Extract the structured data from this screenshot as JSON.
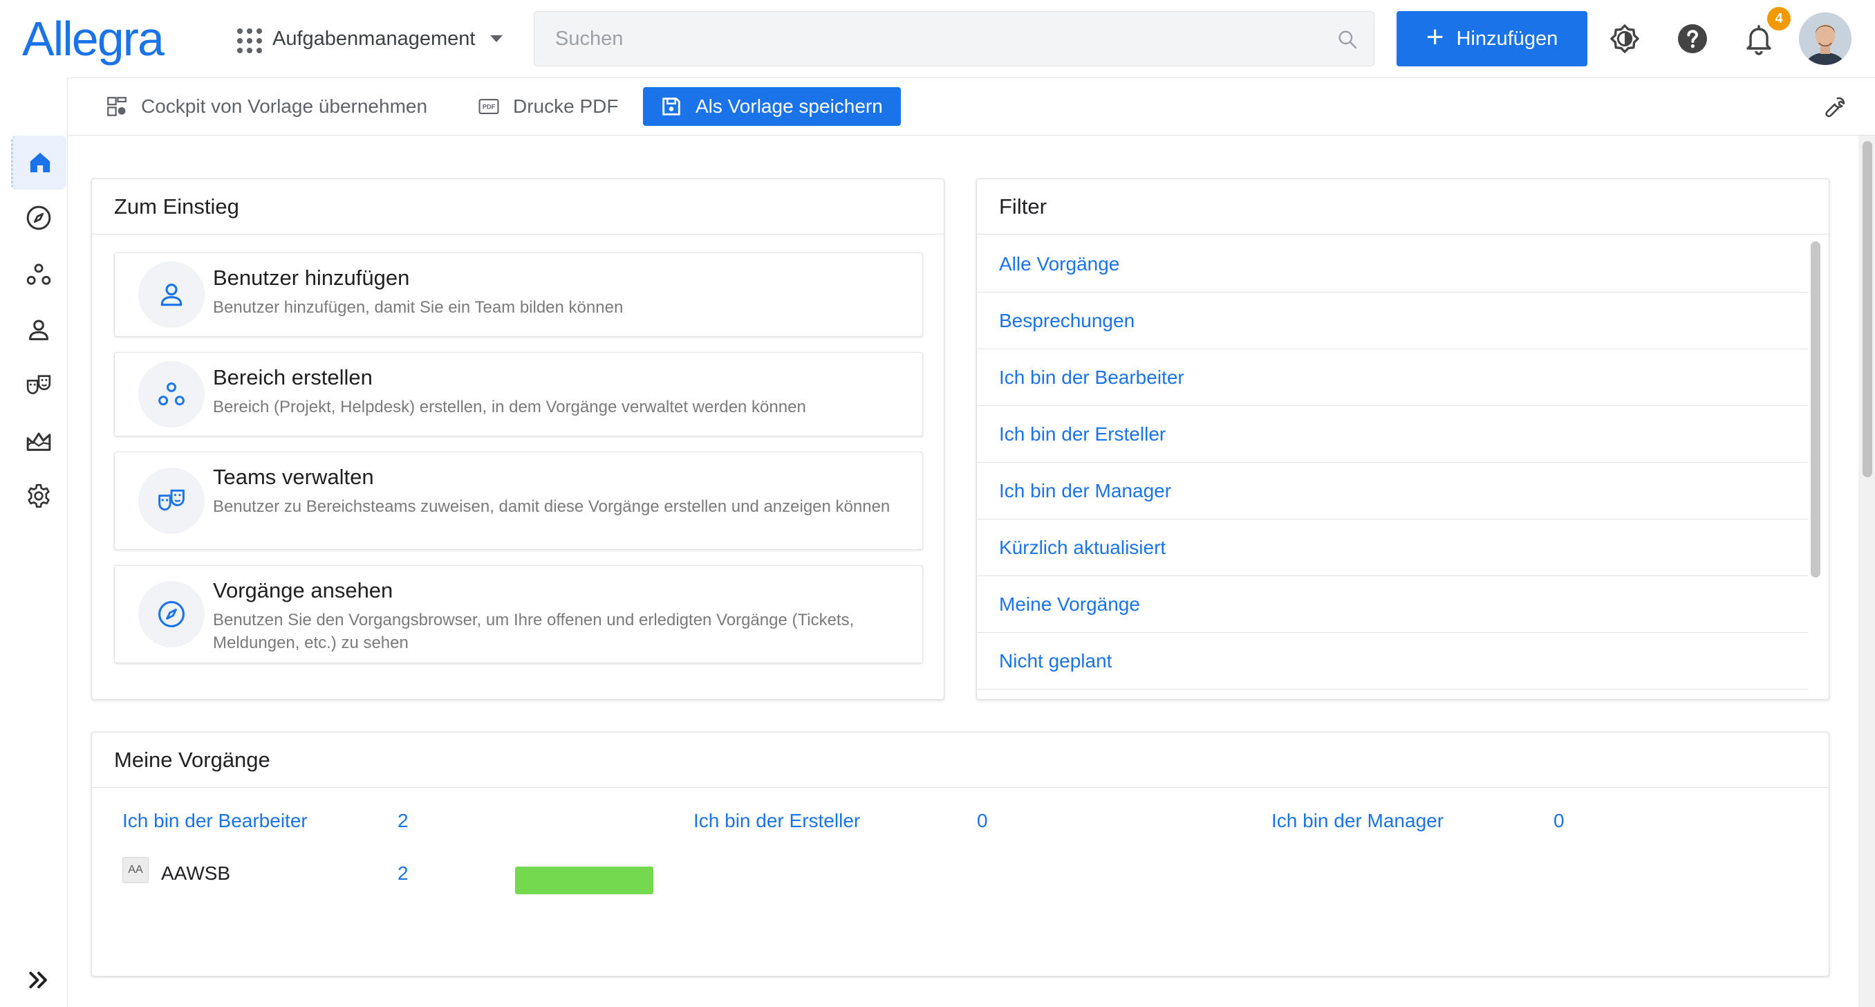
{
  "header": {
    "logo": "Allegra",
    "app_switcher": "Aufgabenmanagement",
    "search_placeholder": "Suchen",
    "add_button": "Hinzufügen",
    "notifications_count": "4"
  },
  "toolbar": {
    "cockpit": "Cockpit von Vorlage übernehmen",
    "print_pdf": "Drucke PDF",
    "save_template": "Als Vorlage speichern"
  },
  "getting_started": {
    "title": "Zum Einstieg",
    "items": [
      {
        "title": "Benutzer hinzufügen",
        "desc": "Benutzer hinzufügen, damit Sie ein Team bilden können"
      },
      {
        "title": "Bereich erstellen",
        "desc": "Bereich (Projekt, Helpdesk) erstellen, in dem Vorgänge verwaltet werden können"
      },
      {
        "title": "Teams verwalten",
        "desc": "Benutzer zu Bereichsteams zuweisen, damit diese Vorgänge erstellen und anzeigen können"
      },
      {
        "title": "Vorgänge ansehen",
        "desc": "Benutzen Sie den Vorgangsbrowser, um Ihre offenen und erledigten Vorgänge (Tickets, Meldungen, etc.) zu sehen"
      }
    ]
  },
  "filter": {
    "title": "Filter",
    "items": [
      "Alle Vorgänge",
      "Besprechungen",
      "Ich bin der Bearbeiter",
      "Ich bin der Ersteller",
      "Ich bin der Manager",
      "Kürzlich aktualisiert",
      "Meine Vorgänge",
      "Nicht geplant"
    ]
  },
  "my_tasks": {
    "title": "Meine Vorgänge",
    "summary": [
      {
        "label": "Ich bin der Bearbeiter",
        "count": "2"
      },
      {
        "label": "Ich bin der Ersteller",
        "count": "0"
      },
      {
        "label": "Ich bin der Manager",
        "count": "0"
      }
    ],
    "rows": [
      {
        "chip": "AA",
        "name": "AAWSB",
        "count": "2",
        "progress": 1.0
      }
    ]
  },
  "colors": {
    "accent": "#1a73e8",
    "progress": "#74d94f",
    "badge": "#f29900"
  }
}
